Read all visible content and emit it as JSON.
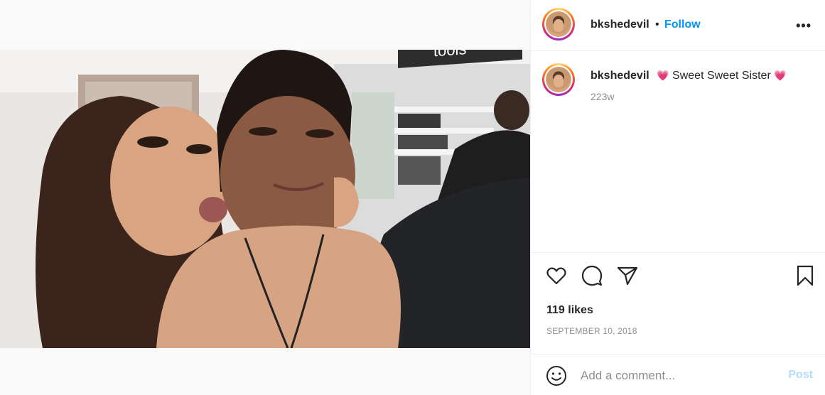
{
  "post": {
    "username": "bkshedevil",
    "separator": "•",
    "follow_label": "Follow",
    "more_label": "•••",
    "caption": {
      "username": "bkshedevil",
      "emoji_left": "💗",
      "text": "Sweet Sweet Sister",
      "emoji_right": "💗",
      "time_ago": "223w"
    },
    "likes": "119 likes",
    "date": "SEPTEMBER 10, 2018",
    "comment": {
      "placeholder": "Add a comment...",
      "post_label": "Post"
    },
    "store_sign": "tools"
  },
  "colors": {
    "accent": "#0095f6",
    "post_disabled": "#b2dffc",
    "muted": "#8e8e8e"
  }
}
